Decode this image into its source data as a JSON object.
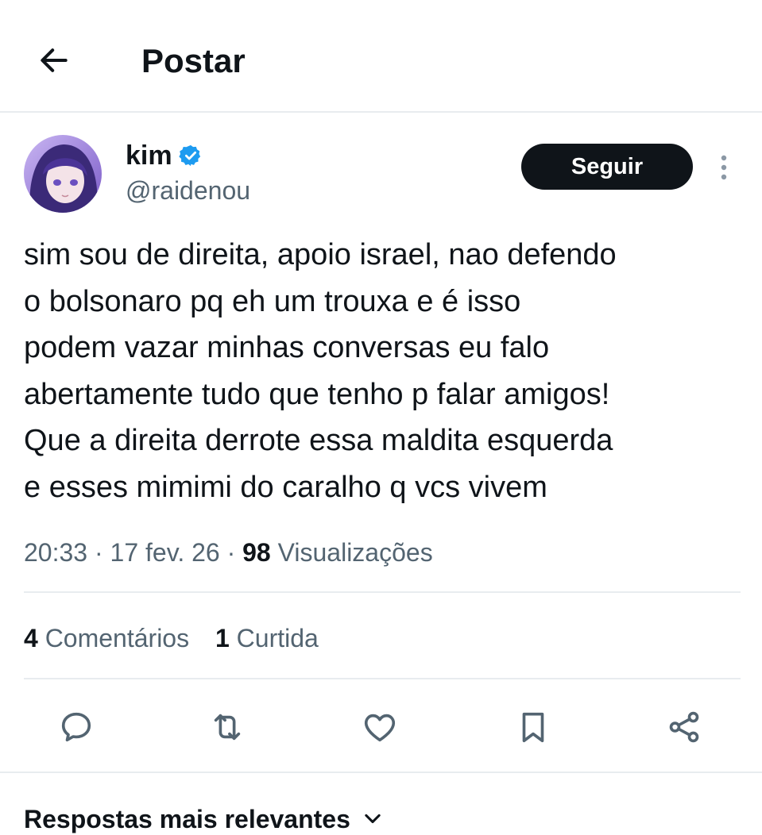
{
  "header": {
    "title": "Postar"
  },
  "author": {
    "name": "kim",
    "handle": "@raidenou",
    "verified": true
  },
  "follow_label": "Seguir",
  "tweet": {
    "lines": [
      "sim sou de direita, apoio israel, nao defendo",
      "o bolsonaro pq eh um trouxa e é isso",
      "podem vazar minhas conversas eu falo",
      "abertamente tudo que tenho p falar amigos!",
      "Que a direita derrote essa maldita esquerda",
      "e esses mimimi do caralho q vcs vivem"
    ]
  },
  "meta": {
    "time": "20:33",
    "sep": "·",
    "date": "17 fev. 26",
    "views_count": "98",
    "views_label": "Visualizações"
  },
  "stats": {
    "comments_count": "4",
    "comments_label": "Comentários",
    "likes_count": "1",
    "likes_label": "Curtida"
  },
  "replies": {
    "sort_label": "Respostas mais relevantes"
  },
  "icons": [
    "back-arrow-icon",
    "verified-badge-icon",
    "more-options-icon",
    "comment-icon",
    "repost-icon",
    "like-icon",
    "bookmark-icon",
    "share-icon",
    "chevron-down-icon"
  ],
  "colors": {
    "verified": "#1d9bf0",
    "follow_bg": "#0f1419",
    "secondary_text": "#536471",
    "divider": "#e8ecef"
  }
}
